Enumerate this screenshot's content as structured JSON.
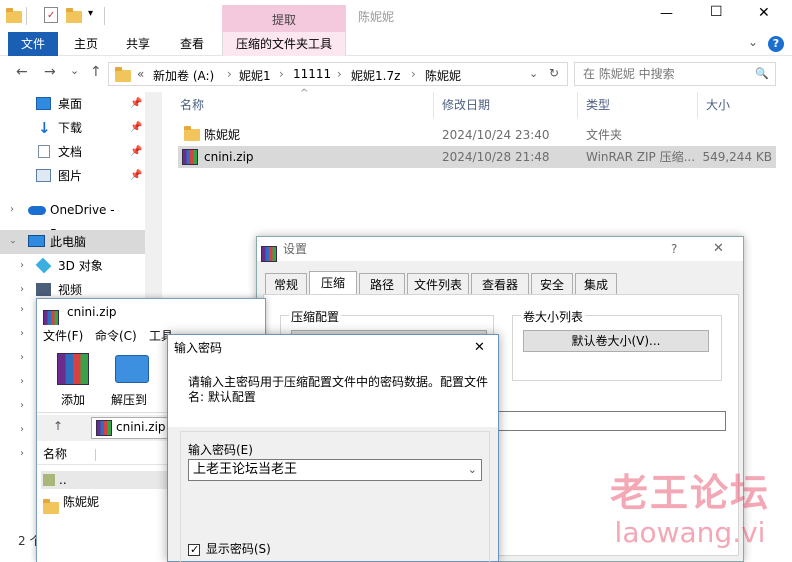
{
  "titlebar": {
    "title": "陈妮妮",
    "min": "—",
    "max": "☐",
    "close": "✕"
  },
  "ribbon": {
    "file": "文件",
    "home": "主页",
    "share": "共享",
    "view": "查看",
    "extract_ctx": "提取",
    "compressed_tools": "压缩的文件夹工具",
    "collapse": "⌄",
    "help": "?"
  },
  "address": {
    "back": "←",
    "forward": "→",
    "recent": "⌄",
    "up": "↑",
    "crumbs": [
      "«",
      "新加卷 (A:)",
      "›",
      "妮妮1",
      "›",
      "11111",
      "›",
      "妮妮1.7z",
      "›",
      "陈妮妮"
    ],
    "dropdown": "⌄",
    "refresh": "↻",
    "search_placeholder": "在 陈妮妮 中搜索",
    "search_icon": "🔍"
  },
  "nav": {
    "items": [
      {
        "label": "桌面",
        "pin": "📌"
      },
      {
        "label": "下载",
        "pin": "📌"
      },
      {
        "label": "文档",
        "pin": "📌"
      },
      {
        "label": "图片",
        "pin": "📌"
      },
      {
        "label": "OneDrive - Perso"
      },
      {
        "label": "此电脑"
      },
      {
        "label": "3D 对象"
      },
      {
        "label": "视频"
      }
    ],
    "chevron": "›",
    "status": "2 个"
  },
  "files": {
    "columns": [
      "名称",
      "修改日期",
      "类型",
      "大小"
    ],
    "sort_arrow": "^",
    "rows": [
      {
        "name": "陈妮妮",
        "date": "2024/10/24 23:40",
        "type": "文件夹",
        "size": ""
      },
      {
        "name": "cnini.zip",
        "date": "2024/10/28 21:48",
        "type": "WinRAR ZIP 压缩...",
        "size": "549,244 KB"
      }
    ]
  },
  "settings": {
    "title": "设置",
    "help": "?",
    "close": "✕",
    "tabs": [
      "常规",
      "压缩",
      "路径",
      "文件列表",
      "查看器",
      "安全",
      "集成"
    ],
    "group_profile": "压缩配置",
    "group_volumes": "卷大小列表",
    "btn_default_volume": "默认卷大小(V)..."
  },
  "winrar": {
    "title": "cnini.zip",
    "menu": [
      "文件(F)",
      "命令(C)",
      "工具"
    ],
    "tools": {
      "add": "添加",
      "extract": "解压到"
    },
    "path": "cnini.zip -",
    "up": "↑",
    "list_header": "名称",
    "list_items": [
      "..",
      "陈妮妮"
    ]
  },
  "password": {
    "title": "输入密码",
    "close": "✕",
    "message": "请输入主密码用于压缩配置文件中的密码数据。配置文件名: 默认配置",
    "label": "输入密码(E)",
    "value": "上老王论坛当老王",
    "dropdown": "⌄",
    "show_label": "显示密码(S)",
    "show_checked": true
  },
  "watermark": {
    "line1": "老王论坛",
    "line2": "laowang.vi"
  }
}
